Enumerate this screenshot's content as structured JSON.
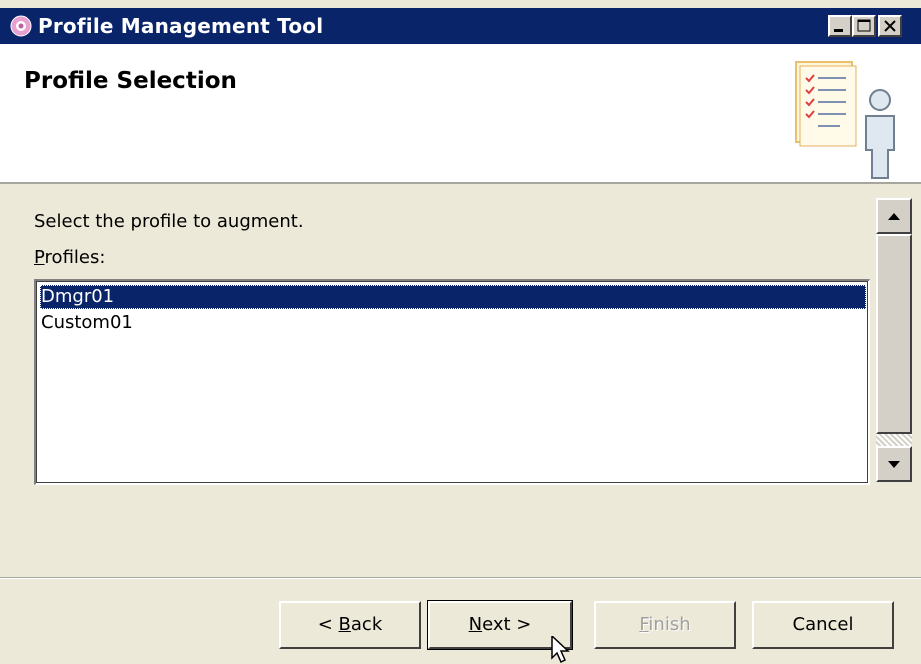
{
  "window": {
    "title": "Profile Management Tool",
    "icon": "app-gear-icon"
  },
  "header": {
    "title": "Profile Selection",
    "graphic_icon": "profile-checklist-icon"
  },
  "body": {
    "instruction": "Select the profile to augment.",
    "profiles_label_mnemonic": "P",
    "profiles_label_rest": "rofiles:",
    "profiles": [
      {
        "label": "Dmgr01",
        "selected": true
      },
      {
        "label": "Custom01",
        "selected": false
      }
    ]
  },
  "buttons": {
    "back_prefix": "< ",
    "back_mnemonic": "B",
    "back_rest": "ack",
    "next_mnemonic": "N",
    "next_rest": "ext >",
    "finish_mnemonic": "F",
    "finish_rest": "inish",
    "finish_enabled": false,
    "cancel": "Cancel"
  },
  "colors": {
    "titlebar": "#0a246a",
    "selection": "#0a246a",
    "dialog_bg": "#ece9d8"
  }
}
